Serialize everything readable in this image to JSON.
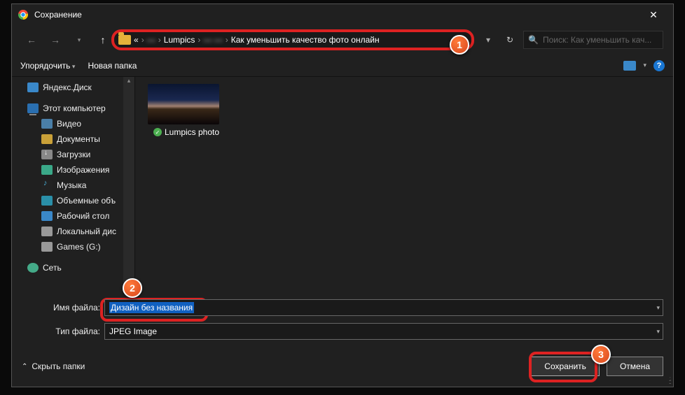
{
  "title": "Сохранение",
  "nav": {
    "crumbs": [
      "«",
      "—",
      "Lumpics",
      "— —",
      "Как уменьшить качество фото онлайн"
    ],
    "search_placeholder": "Поиск: Как уменьшить кач..."
  },
  "toolbar": {
    "organize": "Упорядочить",
    "new_folder": "Новая папка"
  },
  "sidebar": {
    "items": [
      {
        "label": "Яндекс.Диск",
        "ico": "ico-yd",
        "indent": false
      },
      {
        "spacer": true
      },
      {
        "label": "Этот компьютер",
        "ico": "ico-pc",
        "indent": false
      },
      {
        "label": "Видео",
        "ico": "ico-vid",
        "indent": true
      },
      {
        "label": "Документы",
        "ico": "ico-doc",
        "indent": true
      },
      {
        "label": "Загрузки",
        "ico": "ico-dl",
        "indent": true
      },
      {
        "label": "Изображения",
        "ico": "ico-img",
        "indent": true
      },
      {
        "label": "Музыка",
        "ico": "ico-mus",
        "indent": true
      },
      {
        "label": "Объемные объ",
        "ico": "ico-3d",
        "indent": true
      },
      {
        "label": "Рабочий стол",
        "ico": "ico-desk",
        "indent": true
      },
      {
        "label": "Локальный дис",
        "ico": "ico-disk",
        "indent": true
      },
      {
        "label": "Games (G:)",
        "ico": "ico-disk",
        "indent": true
      },
      {
        "spacer": true
      },
      {
        "label": "Сеть",
        "ico": "ico-net",
        "indent": false
      }
    ]
  },
  "content": {
    "file_label": "Lumpics photo"
  },
  "fields": {
    "name_label": "Имя файла:",
    "name_value": "Дизайн без названия",
    "type_label": "Тип файла:",
    "type_value": "JPEG Image"
  },
  "footer": {
    "hide_folders": "Скрыть папки",
    "save": "Сохранить",
    "cancel": "Отмена"
  },
  "markers": {
    "m1": "1",
    "m2": "2",
    "m3": "3"
  }
}
